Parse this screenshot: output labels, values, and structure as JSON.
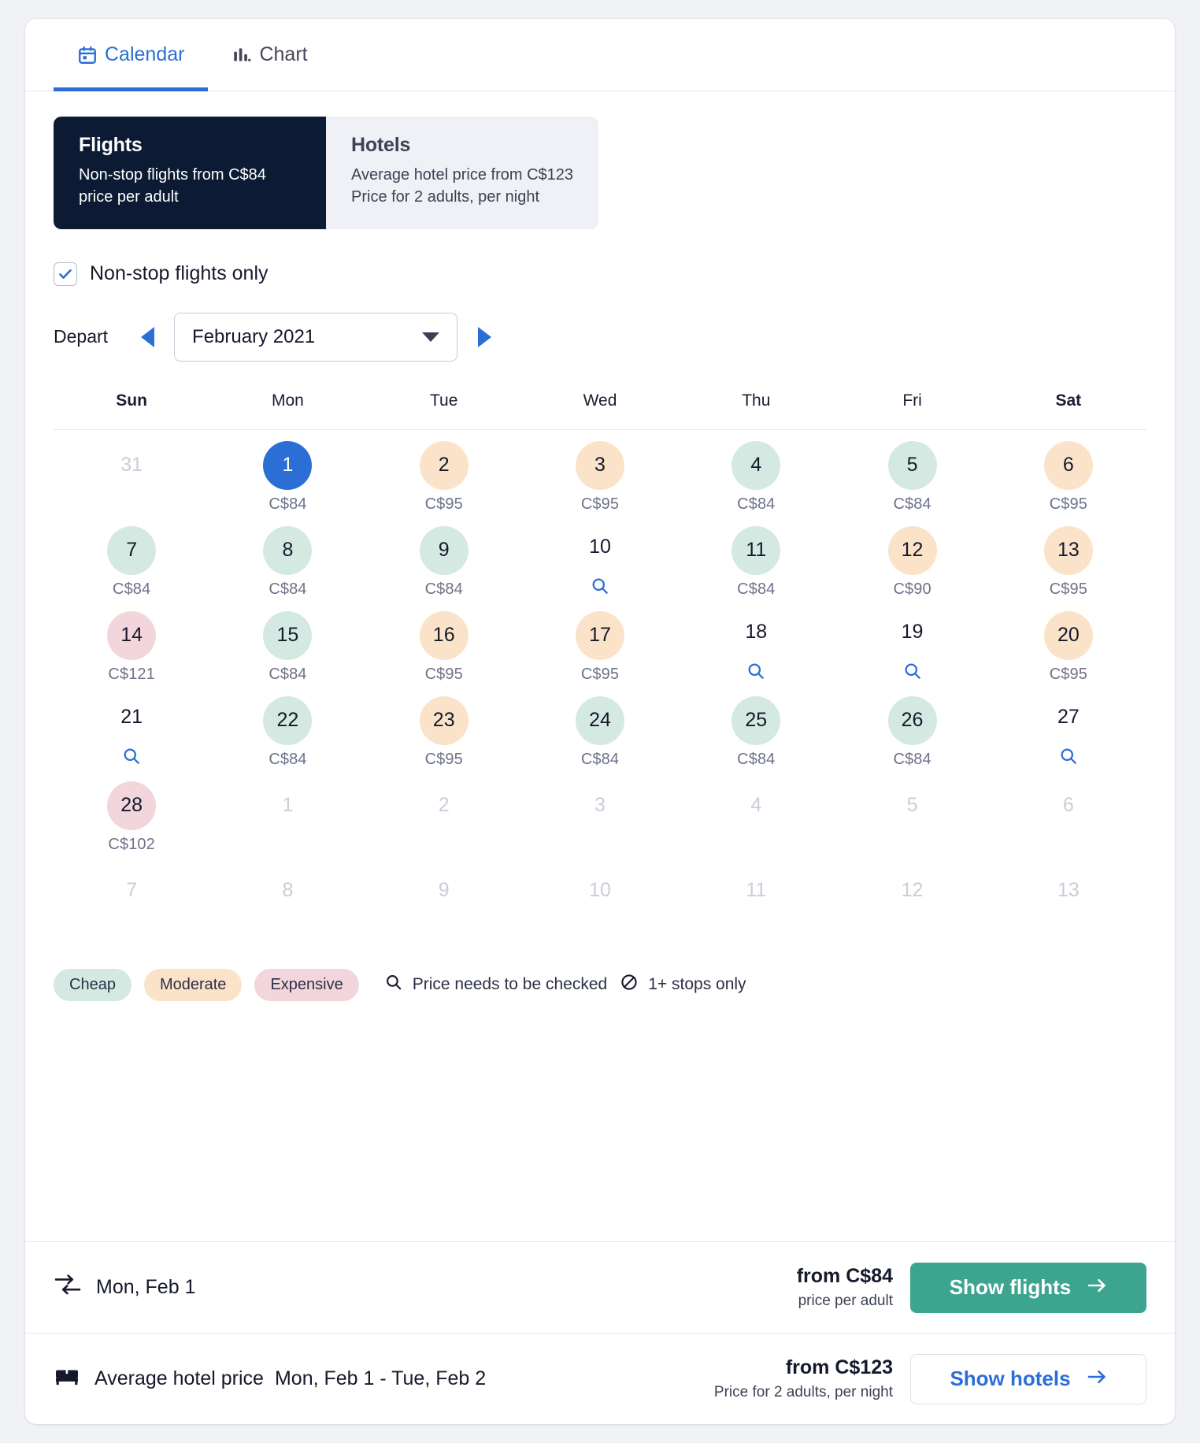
{
  "tabs": [
    {
      "label": "Calendar",
      "icon": "calendar-icon",
      "active": true
    },
    {
      "label": "Chart",
      "icon": "bar-chart-icon",
      "active": false
    }
  ],
  "segment": {
    "flights": {
      "title": "Flights",
      "line1": "Non-stop flights from C$84",
      "line2": "price per adult"
    },
    "hotels": {
      "title": "Hotels",
      "line1": "Average hotel price from C$123",
      "line2": "Price for 2 adults, per night"
    }
  },
  "nonstop_checkbox": {
    "label": "Non-stop flights only",
    "checked": true
  },
  "depart": {
    "label": "Depart",
    "month_value": "February 2021",
    "prev_icon": "triangle-left-icon",
    "next_icon": "triangle-right-icon",
    "caret_icon": "chevron-down-icon"
  },
  "calendar": {
    "weekdays": [
      "Sun",
      "Mon",
      "Tue",
      "Wed",
      "Thu",
      "Fri",
      "Sat"
    ],
    "weekend_indexes": [
      0,
      6
    ],
    "cells": [
      {
        "day": "31",
        "state": "out",
        "price": ""
      },
      {
        "day": "1",
        "state": "selected",
        "price": "C$84"
      },
      {
        "day": "2",
        "state": "moderate",
        "price": "C$95"
      },
      {
        "day": "3",
        "state": "moderate",
        "price": "C$95"
      },
      {
        "day": "4",
        "state": "cheap",
        "price": "C$84"
      },
      {
        "day": "5",
        "state": "cheap",
        "price": "C$84"
      },
      {
        "day": "6",
        "state": "moderate",
        "price": "C$95"
      },
      {
        "day": "7",
        "state": "cheap",
        "price": "C$84"
      },
      {
        "day": "8",
        "state": "cheap",
        "price": "C$84"
      },
      {
        "day": "9",
        "state": "cheap",
        "price": "C$84"
      },
      {
        "day": "10",
        "state": "plain",
        "price": "",
        "search": true
      },
      {
        "day": "11",
        "state": "cheap",
        "price": "C$84"
      },
      {
        "day": "12",
        "state": "moderate",
        "price": "C$90"
      },
      {
        "day": "13",
        "state": "moderate",
        "price": "C$95"
      },
      {
        "day": "14",
        "state": "expensive",
        "price": "C$121"
      },
      {
        "day": "15",
        "state": "cheap",
        "price": "C$84"
      },
      {
        "day": "16",
        "state": "moderate",
        "price": "C$95"
      },
      {
        "day": "17",
        "state": "moderate",
        "price": "C$95"
      },
      {
        "day": "18",
        "state": "plain",
        "price": "",
        "search": true
      },
      {
        "day": "19",
        "state": "plain",
        "price": "",
        "search": true
      },
      {
        "day": "20",
        "state": "moderate",
        "price": "C$95"
      },
      {
        "day": "21",
        "state": "plain",
        "price": "",
        "search": true
      },
      {
        "day": "22",
        "state": "cheap",
        "price": "C$84"
      },
      {
        "day": "23",
        "state": "moderate",
        "price": "C$95"
      },
      {
        "day": "24",
        "state": "cheap",
        "price": "C$84"
      },
      {
        "day": "25",
        "state": "cheap",
        "price": "C$84"
      },
      {
        "day": "26",
        "state": "cheap",
        "price": "C$84"
      },
      {
        "day": "27",
        "state": "plain",
        "price": "",
        "search": true
      },
      {
        "day": "28",
        "state": "expensive",
        "price": "C$102"
      },
      {
        "day": "1",
        "state": "out",
        "price": ""
      },
      {
        "day": "2",
        "state": "out",
        "price": ""
      },
      {
        "day": "3",
        "state": "out",
        "price": ""
      },
      {
        "day": "4",
        "state": "out",
        "price": ""
      },
      {
        "day": "5",
        "state": "out",
        "price": ""
      },
      {
        "day": "6",
        "state": "out",
        "price": ""
      },
      {
        "day": "7",
        "state": "out",
        "price": ""
      },
      {
        "day": "8",
        "state": "out",
        "price": ""
      },
      {
        "day": "9",
        "state": "out",
        "price": ""
      },
      {
        "day": "10",
        "state": "out",
        "price": ""
      },
      {
        "day": "11",
        "state": "out",
        "price": ""
      },
      {
        "day": "12",
        "state": "out",
        "price": ""
      },
      {
        "day": "13",
        "state": "out",
        "price": ""
      }
    ]
  },
  "legend": {
    "cheap": "Cheap",
    "moderate": "Moderate",
    "expensive": "Expensive",
    "price_check": "Price needs to be checked",
    "stops": "1+ stops only",
    "search_icon": "magnifier-icon",
    "no_entry_icon": "no-entry-icon"
  },
  "footer": {
    "flight": {
      "icon": "flight-transfer-icon",
      "label": "Mon, Feb 1",
      "price_main": "from C$84",
      "price_sub": "price per adult",
      "button": "Show flights",
      "button_icon": "arrow-right-icon"
    },
    "hotel": {
      "icon": "bed-icon",
      "label_a": "Average hotel price",
      "label_b": "Mon, Feb 1 - Tue, Feb 2",
      "price_main": "from C$123",
      "price_sub": "Price for 2 adults, per night",
      "button": "Show hotels",
      "button_icon": "arrow-right-icon"
    }
  },
  "colors": {
    "accent_blue": "#2b6fd6",
    "dark_navy": "#0c1b33",
    "green_button": "#3da58f",
    "cheap": "#d4e9e1",
    "moderate": "#fbe3c9",
    "expensive": "#f2d6dc"
  }
}
